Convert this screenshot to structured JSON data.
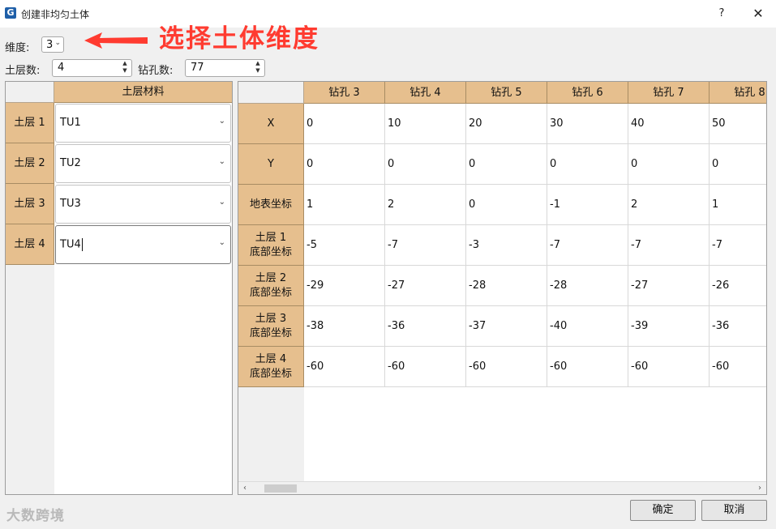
{
  "window": {
    "title": "创建非均匀土体",
    "logo": "G",
    "help_label": "?",
    "close_label": "✕"
  },
  "annotation": {
    "text": "选择土体维度",
    "color": "#ff3b30"
  },
  "params": {
    "dimension_label": "维度:",
    "dimension_value": "3",
    "soil_layers_label": "土层数:",
    "soil_layers_value": "4",
    "boreholes_label": "钻孔数:",
    "boreholes_value": "77"
  },
  "material_table": {
    "header": "土层材料",
    "rows": [
      {
        "label": "土层 1",
        "material": "TU1"
      },
      {
        "label": "土层 2",
        "material": "TU2"
      },
      {
        "label": "土层 3",
        "material": "TU3"
      },
      {
        "label": "土层 4",
        "material": "TU4"
      }
    ]
  },
  "borehole_table": {
    "columns": [
      "钻孔 3",
      "钻孔 4",
      "钻孔 5",
      "钻孔 6",
      "钻孔 7",
      "钻孔 8"
    ],
    "rows": [
      {
        "label": "X",
        "values": [
          "0",
          "10",
          "20",
          "30",
          "40",
          "50"
        ]
      },
      {
        "label": "Y",
        "values": [
          "0",
          "0",
          "0",
          "0",
          "0",
          "0"
        ]
      },
      {
        "label": "地表坐标",
        "values": [
          "1",
          "2",
          "0",
          "-1",
          "2",
          "1"
        ]
      },
      {
        "label": "土层 1\n底部坐标",
        "values": [
          "-5",
          "-7",
          "-3",
          "-7",
          "-7",
          "-7"
        ]
      },
      {
        "label": "土层 2\n底部坐标",
        "values": [
          "-29",
          "-27",
          "-28",
          "-28",
          "-27",
          "-26"
        ]
      },
      {
        "label": "土层 3\n底部坐标",
        "values": [
          "-38",
          "-36",
          "-37",
          "-40",
          "-39",
          "-36"
        ]
      },
      {
        "label": "土层 4\n底部坐标",
        "values": [
          "-60",
          "-60",
          "-60",
          "-60",
          "-60",
          "-60"
        ]
      }
    ]
  },
  "buttons": {
    "ok": "确定",
    "cancel": "取消"
  },
  "watermark": "大数跨境",
  "colors": {
    "header_bg": "#e6bf8e",
    "annotation": "#ff3b30"
  }
}
